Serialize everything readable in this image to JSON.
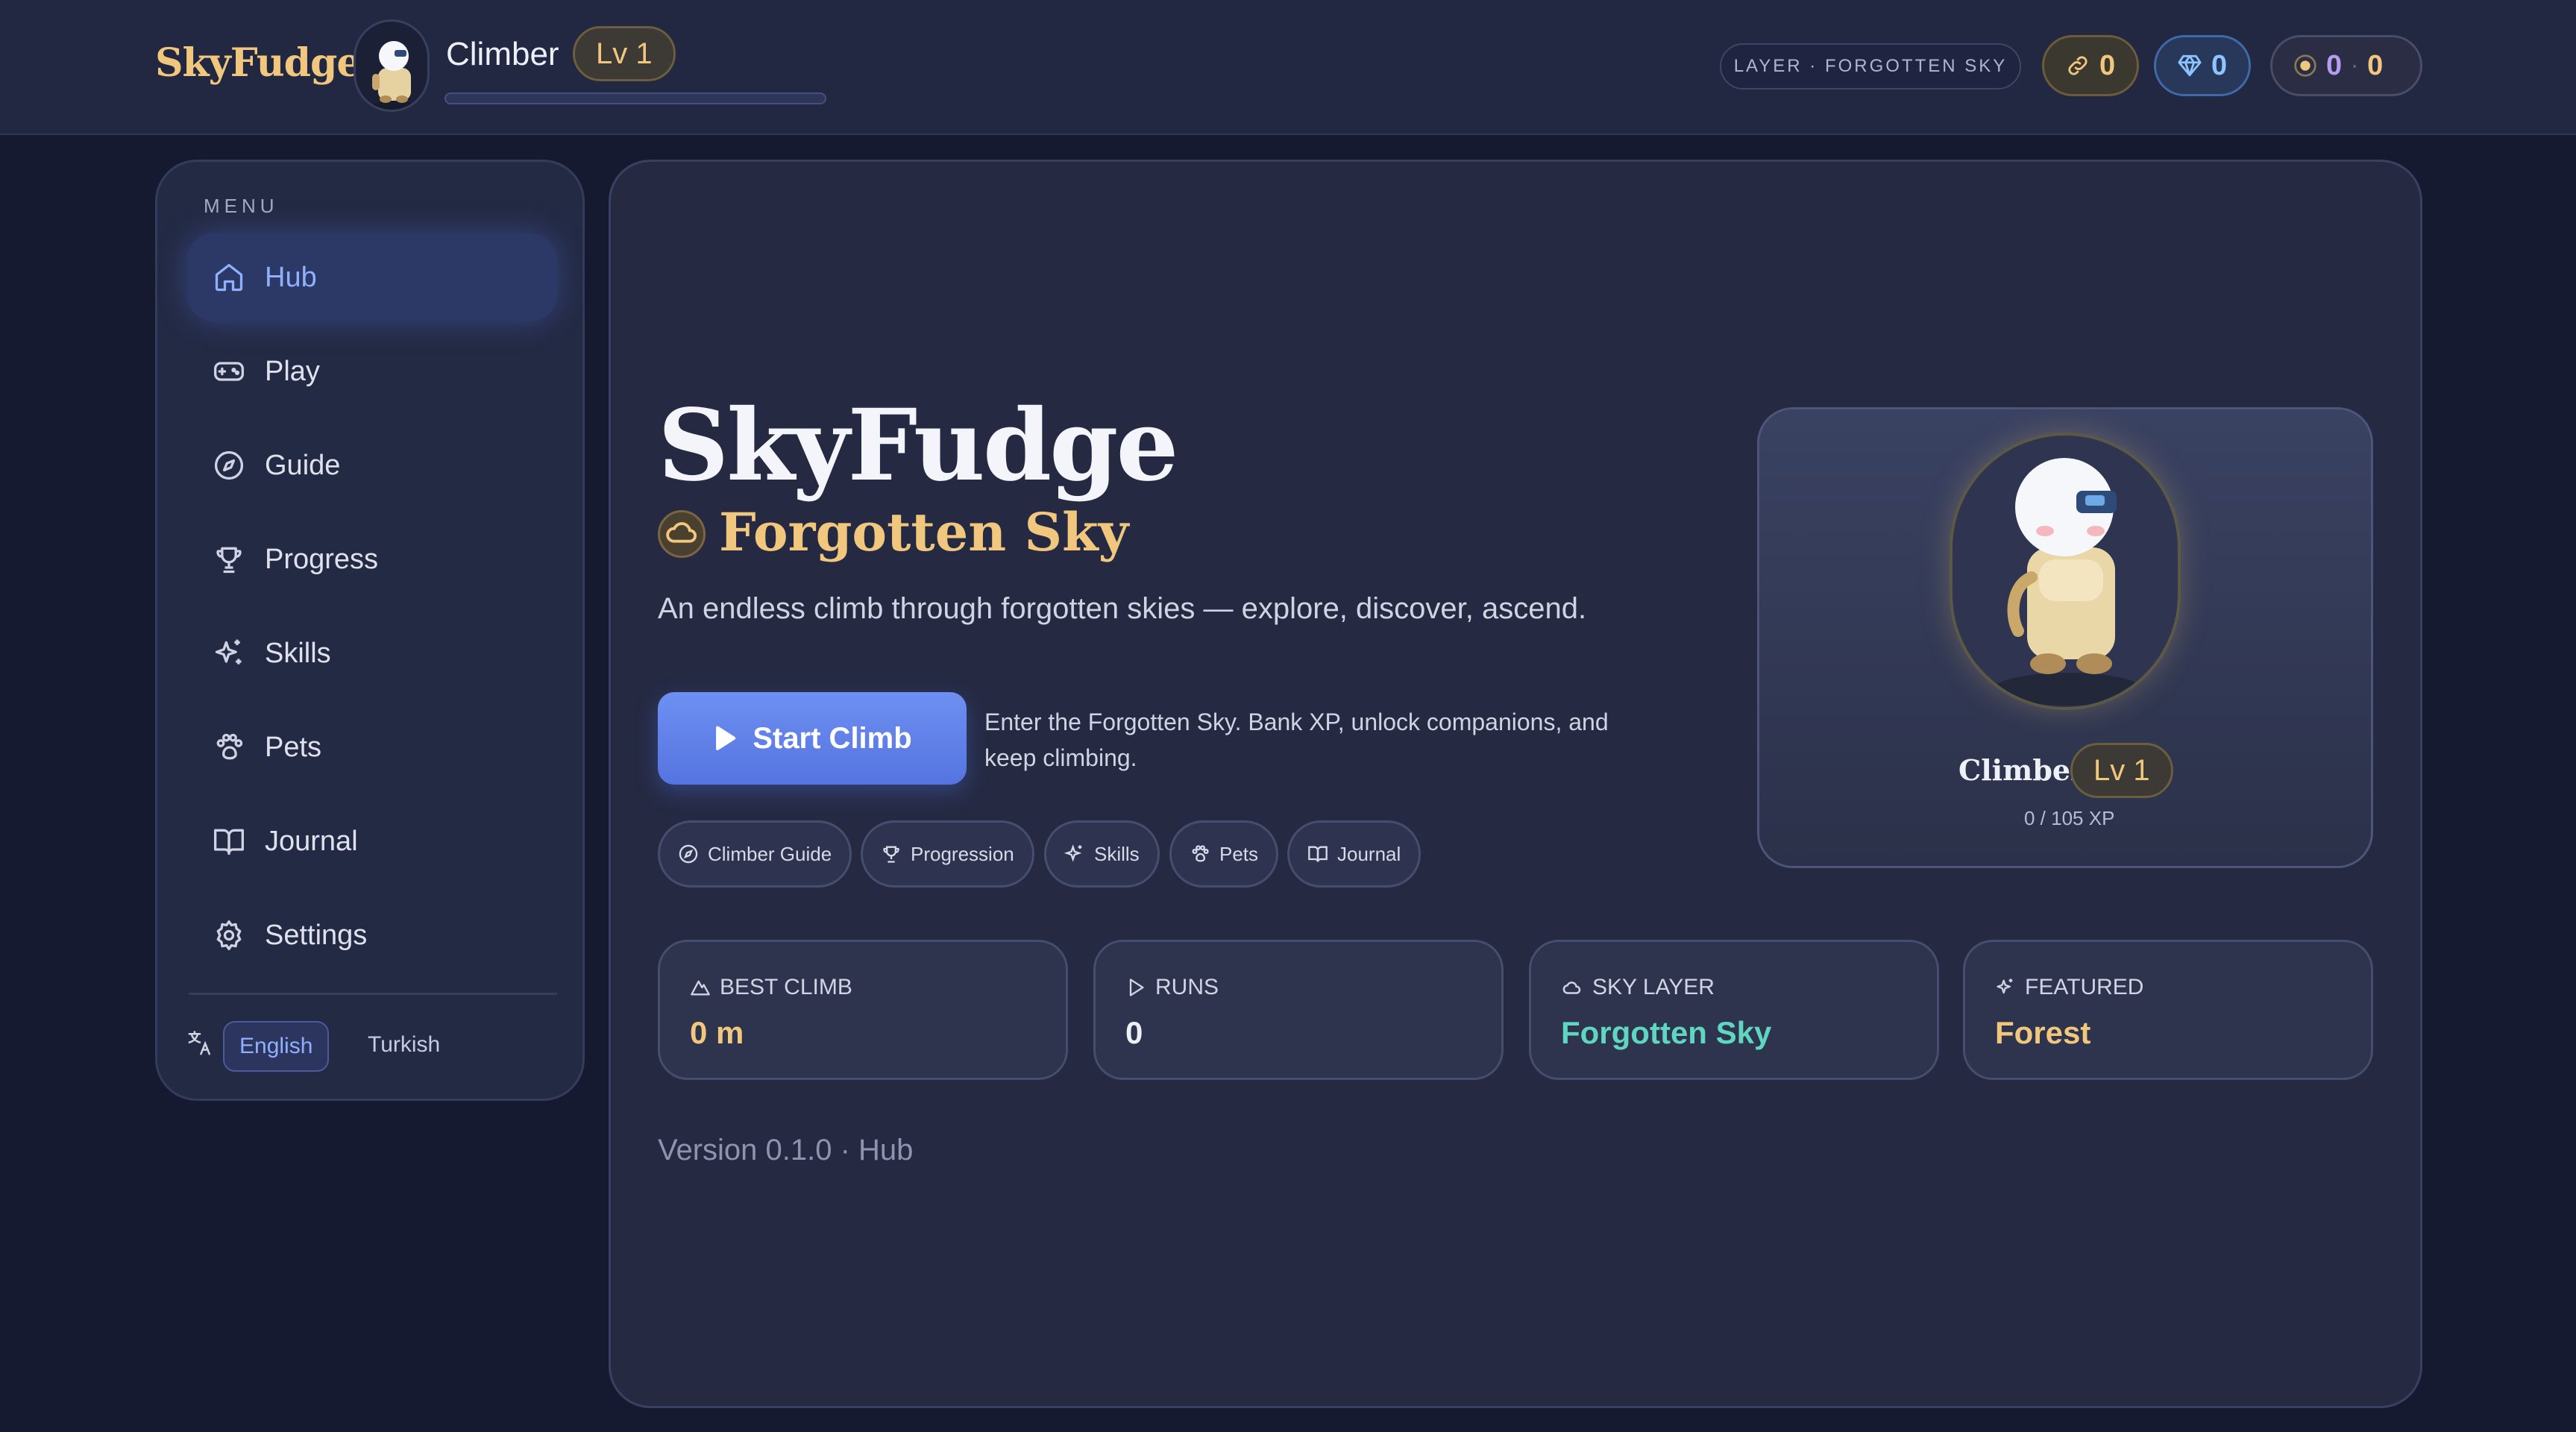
{
  "brand": "SkyFudge",
  "player": {
    "name": "Climber",
    "level": "Lv 1",
    "xp_progress": 0
  },
  "header": {
    "layer_chip": "LAYER · FORGOTTEN SKY",
    "links_count": "0",
    "gems_count": "0",
    "coins_a": "0",
    "coins_separator": "·",
    "coins_b": "0"
  },
  "sidebar": {
    "menu_label": "MENU",
    "items": [
      {
        "label": "Hub",
        "icon": "home-icon",
        "active": true
      },
      {
        "label": "Play",
        "icon": "gamepad-icon"
      },
      {
        "label": "Guide",
        "icon": "compass-icon"
      },
      {
        "label": "Progress",
        "icon": "trophy-icon"
      },
      {
        "label": "Skills",
        "icon": "sparkles-icon"
      },
      {
        "label": "Pets",
        "icon": "paw-icon"
      },
      {
        "label": "Journal",
        "icon": "book-icon"
      },
      {
        "label": "Settings",
        "icon": "gear-icon"
      }
    ],
    "languages": [
      {
        "label": "English",
        "active": true
      },
      {
        "label": "Turkish"
      }
    ]
  },
  "hero": {
    "title": "SkyFudge",
    "subtitle": "Forgotten Sky",
    "tagline": "An endless climb through forgotten skies — explore, discover, ascend.",
    "start_label": "Start Climb",
    "start_hint": "Enter the Forgotten Sky. Bank XP, unlock companions, and keep climbing.",
    "quick_links": [
      {
        "label": "Climber Guide",
        "icon": "compass-icon"
      },
      {
        "label": "Progression",
        "icon": "trophy-icon"
      },
      {
        "label": "Skills",
        "icon": "sparkles-icon"
      },
      {
        "label": "Pets",
        "icon": "paw-icon"
      },
      {
        "label": "Journal",
        "icon": "book-icon"
      }
    ]
  },
  "character": {
    "name": "Climber",
    "level": "Lv 1",
    "xp_text": "0 / 105 XP"
  },
  "stats": [
    {
      "label": "BEST CLIMB",
      "value": "0 m",
      "icon": "mountain-icon",
      "color": "#f0c77c"
    },
    {
      "label": "RUNS",
      "value": "0",
      "icon": "play-icon",
      "color": "#eef0f8"
    },
    {
      "label": "SKY LAYER",
      "value": "Forgotten Sky",
      "icon": "cloud-icon",
      "color": "#5fd6c0"
    },
    {
      "label": "FEATURED",
      "value": "Forest",
      "icon": "sparkles-icon",
      "color": "#f0c77c"
    }
  ],
  "footer": {
    "version": "Version 0.1.0 · Hub"
  },
  "colors": {
    "accent": "#6c8cf0",
    "gold": "#f0c77c",
    "teal": "#5fd6c0",
    "bg": "#151a30"
  }
}
